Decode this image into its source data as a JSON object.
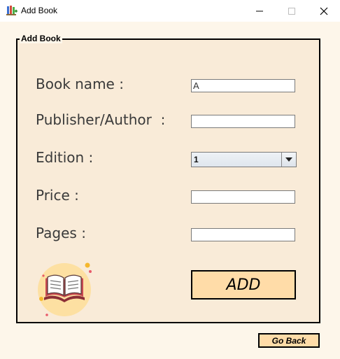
{
  "window": {
    "title": "Add Book",
    "icon": "books-app-icon",
    "controls": [
      "minimize-icon",
      "maximize-icon",
      "close-icon"
    ]
  },
  "panel": {
    "legend": "Add Book"
  },
  "form": {
    "book_name": {
      "label": "Book name :",
      "value": "A"
    },
    "publisher_author": {
      "label": "Publisher/Author  :",
      "value": ""
    },
    "edition": {
      "label": "Edition :",
      "selected": "1"
    },
    "price": {
      "label": "Price :",
      "value": ""
    },
    "pages": {
      "label": "Pages :",
      "value": ""
    }
  },
  "buttons": {
    "add": "ADD",
    "go_back": "Go Back"
  },
  "illustration": {
    "icon": "open-book-icon"
  },
  "colors": {
    "page_bg": "#fdf6ea",
    "panel_bg": "#f9ebd8",
    "button_bg": "#ffdca8",
    "label_text": "#3a3a3a"
  }
}
